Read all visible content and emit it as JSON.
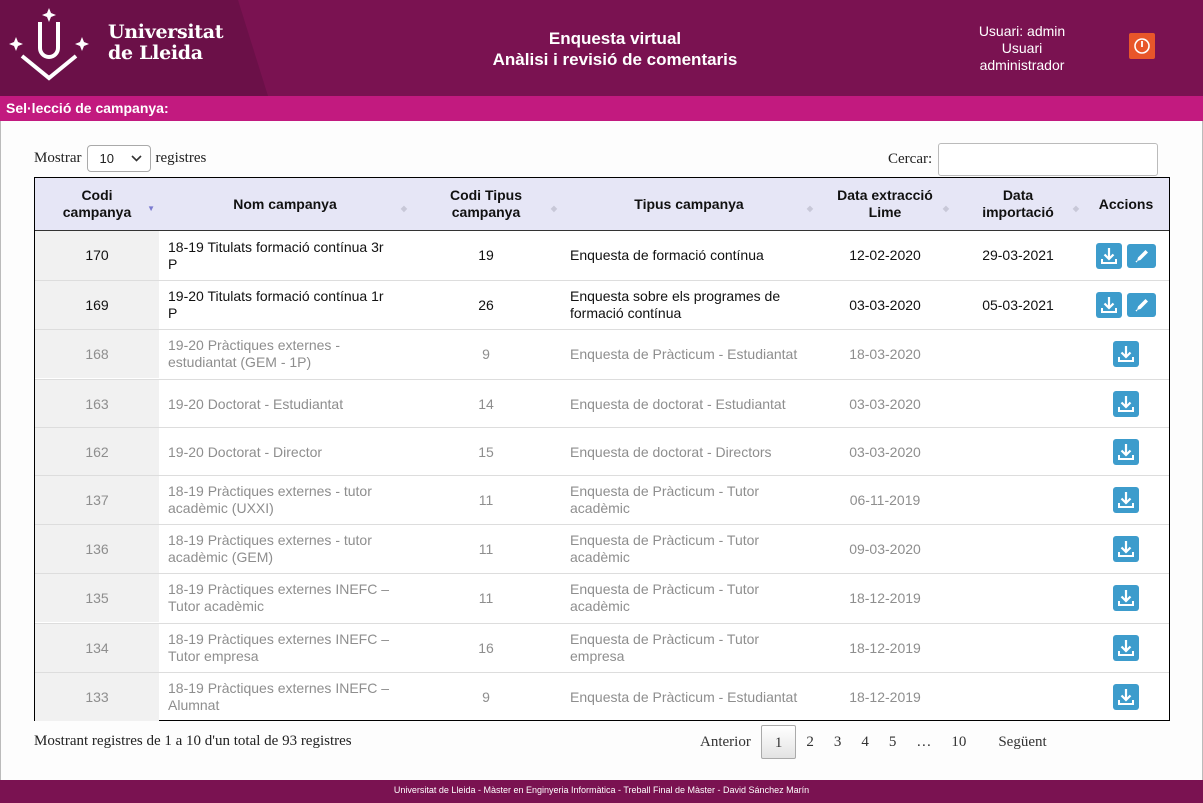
{
  "header": {
    "logo": {
      "line1": "Universitat",
      "line2": "de Lleida"
    },
    "title_line1": "Enquesta virtual",
    "title_line2": "Anàlisi i revisió de comentaris",
    "user_line1": "Usuari: admin",
    "user_line2": "Usuari",
    "user_line3": "administrador",
    "logout_icon": "power-icon"
  },
  "section": {
    "title": "Sel·lecció de campanya:"
  },
  "controls": {
    "show_label": "Mostrar",
    "page_size": "10",
    "records_label": "registres",
    "search_label": "Cercar:",
    "search_value": ""
  },
  "table": {
    "columns": [
      "Codi campanya",
      "Nom campanya",
      "Codi Tipus campanya",
      "Tipus campanya",
      "Data extracció Lime",
      "Data importació",
      "Accions"
    ],
    "rows": [
      {
        "codi": "170",
        "nom": "18-19 Titulats formació contínua 3r P",
        "codi_tipus": "19",
        "tipus": "Enquesta de formació contínua",
        "data_extraccio": "12-02-2020",
        "data_importacio": "29-03-2021"
      },
      {
        "codi": "169",
        "nom": "19-20 Titulats formació contínua 1r P",
        "codi_tipus": "26",
        "tipus": "Enquesta sobre els programes de formació contínua",
        "data_extraccio": "03-03-2020",
        "data_importacio": "05-03-2021"
      },
      {
        "codi": "168",
        "nom": "19-20 Pràctiques externes - estudiantat (GEM - 1P)",
        "codi_tipus": "9",
        "tipus": "Enquesta de Pràcticum - Estudiantat",
        "data_extraccio": "18-03-2020",
        "data_importacio": ""
      },
      {
        "codi": "163",
        "nom": "19-20 Doctorat - Estudiantat",
        "codi_tipus": "14",
        "tipus": "Enquesta de doctorat - Estudiantat",
        "data_extraccio": "03-03-2020",
        "data_importacio": ""
      },
      {
        "codi": "162",
        "nom": "19-20 Doctorat - Director",
        "codi_tipus": "15",
        "tipus": "Enquesta de doctorat - Directors",
        "data_extraccio": "03-03-2020",
        "data_importacio": ""
      },
      {
        "codi": "137",
        "nom": "18-19 Pràctiques externes - tutor acadèmic (UXXI)",
        "codi_tipus": "11",
        "tipus": "Enquesta de Pràcticum - Tutor acadèmic",
        "data_extraccio": "06-11-2019",
        "data_importacio": ""
      },
      {
        "codi": "136",
        "nom": "18-19 Pràctiques externes - tutor acadèmic (GEM)",
        "codi_tipus": "11",
        "tipus": "Enquesta de Pràcticum - Tutor acadèmic",
        "data_extraccio": "09-03-2020",
        "data_importacio": ""
      },
      {
        "codi": "135",
        "nom": "18-19 Pràctiques externes INEFC – Tutor acadèmic",
        "codi_tipus": "11",
        "tipus": "Enquesta de Pràcticum - Tutor acadèmic",
        "data_extraccio": "18-12-2019",
        "data_importacio": ""
      },
      {
        "codi": "134",
        "nom": "18-19 Pràctiques externes INEFC – Tutor empresa",
        "codi_tipus": "16",
        "tipus": "Enquesta de Pràcticum - Tutor empresa",
        "data_extraccio": "18-12-2019",
        "data_importacio": ""
      },
      {
        "codi": "133",
        "nom": "18-19 Pràctiques externes INEFC – Alumnat",
        "codi_tipus": "9",
        "tipus": "Enquesta de Pràcticum - Estudiantat",
        "data_extraccio": "18-12-2019",
        "data_importacio": ""
      }
    ]
  },
  "info": "Mostrant registres de 1 a 10 d'un total de 93 registres",
  "pagination": {
    "previous": "Anterior",
    "pages": [
      "1",
      "2",
      "3",
      "4",
      "5",
      "…",
      "10"
    ],
    "current": "1",
    "next": "Següent"
  },
  "footer": "Universitat de Lleida - Màster en Enginyeria Informàtica - Treball Final de Màster - David Sánchez Marín",
  "colors": {
    "header_bg": "#7a1251",
    "section_bar": "#c21a7f",
    "table_header": "#e6e6f6",
    "action_icon": "#3d9ccc",
    "logout_icon": "#e8562a"
  }
}
